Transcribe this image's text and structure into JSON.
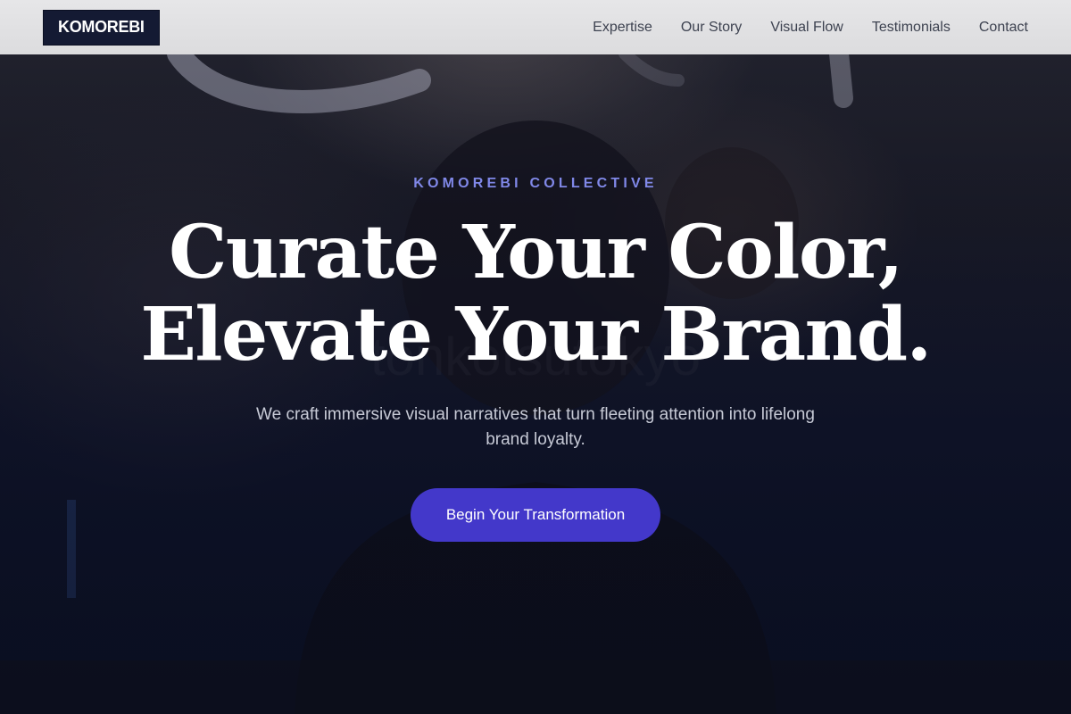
{
  "nav": {
    "brand": "KOMOREBI",
    "links": [
      "Expertise",
      "Our Story",
      "Visual Flow",
      "Testimonials",
      "Contact"
    ]
  },
  "hero": {
    "eyebrow": "KOMOREBI COLLECTIVE",
    "headline_line1": "Curate Your Color,",
    "headline_line2": "Elevate Your Brand.",
    "subtitle": "We craft immersive visual narratives that turn fleeting attention into lifelong brand loyalty.",
    "cta_label": "Begin Your Transformation"
  },
  "colors": {
    "accent": "#4338ca",
    "eyebrow": "#8088e8",
    "brand_bg": "#141a33"
  }
}
